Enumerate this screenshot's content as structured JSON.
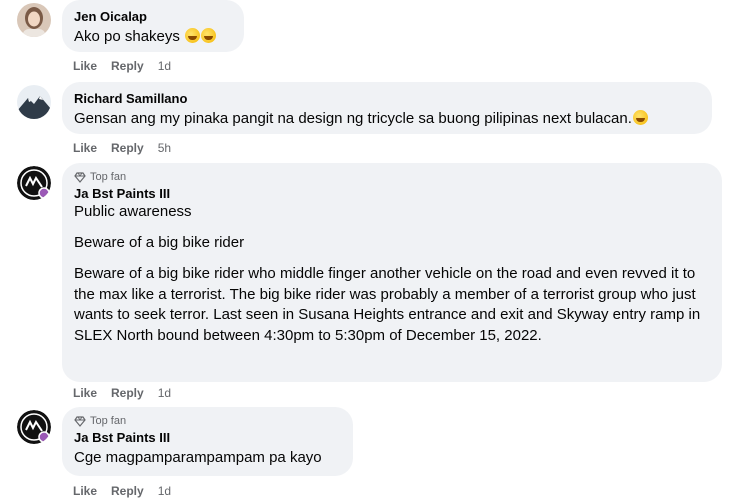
{
  "comments": [
    {
      "name": "Jen Oicalap",
      "text": "Ako po shakeys",
      "emoji_count": 2,
      "actions": {
        "like": "Like",
        "reply": "Reply",
        "time": "1d"
      }
    },
    {
      "name": "Richard Samillano",
      "text": "Gensan ang my pinaka pangit na design ng tricycle sa buong pilipinas next bulacan.",
      "emoji_count": 1,
      "actions": {
        "like": "Like",
        "reply": "Reply",
        "time": "5h"
      }
    },
    {
      "badge": "Top fan",
      "name": "Ja Bst Paints III",
      "paragraphs": [
        "Public awareness",
        "Beware of a big bike rider",
        "Beware of a big bike rider who middle finger another vehicle on the road and even revved it to the max like a terrorist. The big bike rider was probably a member of a terrorist group who just wants to seek terror. Last seen in Susana Heights entrance and exit and Skyway entry ramp in SLEX North bound between 4:30pm to 5:30pm of December 15, 2022."
      ],
      "actions": {
        "like": "Like",
        "reply": "Reply",
        "time": "1d"
      }
    },
    {
      "badge": "Top fan",
      "name": "Ja Bst Paints III",
      "text": "Cge magpamparampampam pa kayo",
      "actions": {
        "like": "Like",
        "reply": "Reply",
        "time": "1d"
      }
    }
  ],
  "colors": {
    "bubble_bg": "#f0f2f5",
    "text": "#050505",
    "secondary": "#65676b"
  }
}
